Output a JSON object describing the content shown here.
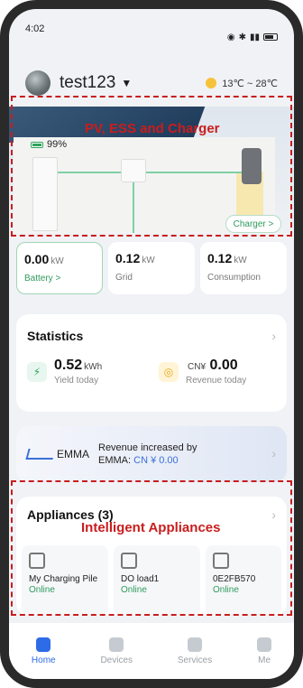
{
  "status_bar": {
    "time": "4:02"
  },
  "header": {
    "username": "test123",
    "weather": {
      "temp_range": "13℃ ~ 28℃",
      "icon": "sun-icon"
    }
  },
  "hero": {
    "battery_soc": "99%",
    "charger_chip": "Charger >"
  },
  "metrics": [
    {
      "value": "0.00",
      "unit": "kW",
      "label": "Battery >"
    },
    {
      "value": "0.12",
      "unit": "kW",
      "label": "Grid"
    },
    {
      "value": "0.12",
      "unit": "kW",
      "label": "Consumption"
    }
  ],
  "statistics": {
    "title": "Statistics",
    "yield": {
      "value": "0.52",
      "unit": "kWh",
      "label": "Yield today"
    },
    "revenue": {
      "currency": "CN¥",
      "value": "0.00",
      "label": "Revenue today"
    }
  },
  "emma": {
    "logo_text": "EMMA",
    "line1": "Revenue increased by",
    "line2_prefix": "EMMA: ",
    "amount": "CN ¥ 0.00"
  },
  "appliances": {
    "title": "Appliances (3)",
    "items": [
      {
        "name": "My Charging Pile",
        "status": "Online"
      },
      {
        "name": "DO load1",
        "status": "Online"
      },
      {
        "name": "0E2FB570",
        "status": "Online"
      }
    ]
  },
  "annotations": {
    "pv": "PV, ESS and Charger",
    "intelligent": "Intelligent Appliances"
  },
  "bottom_nav": [
    {
      "label": "Home",
      "active": true
    },
    {
      "label": "Devices",
      "active": false
    },
    {
      "label": "Services",
      "active": false
    },
    {
      "label": "Me",
      "active": false
    }
  ],
  "colors": {
    "accent": "#2e6be6",
    "green": "#2f9b5d",
    "annotation": "#c91d1d"
  }
}
